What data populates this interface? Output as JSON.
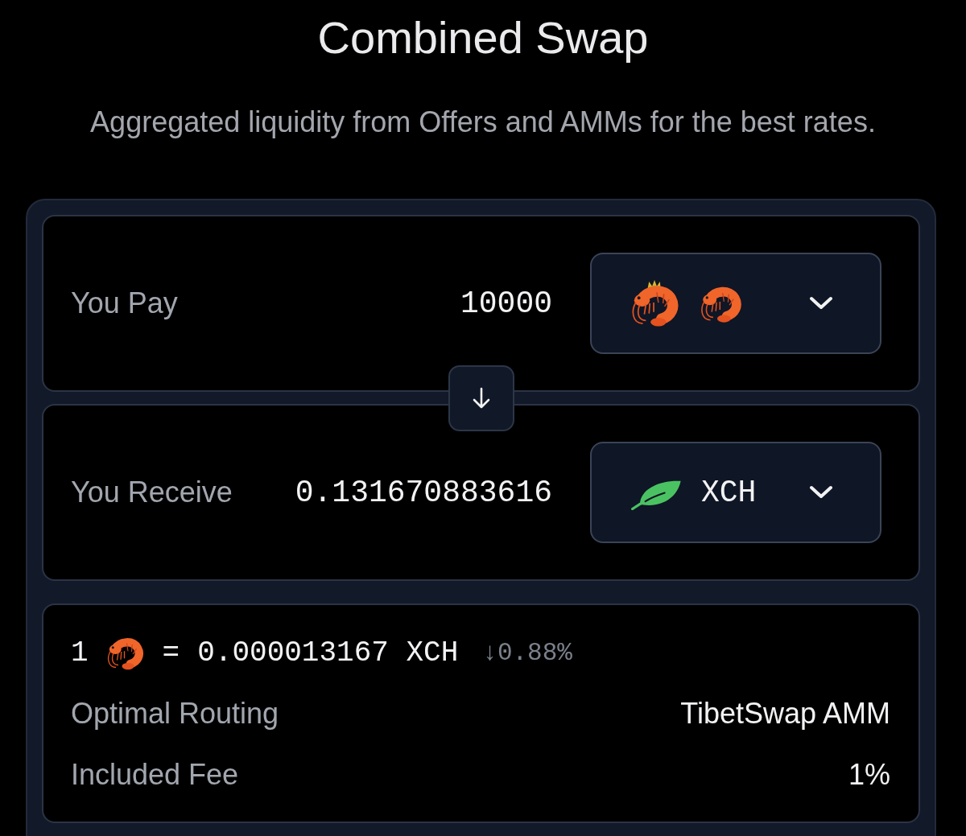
{
  "title": "Combined Swap",
  "subtitle": "Aggregated liquidity from Offers and AMMs for the best rates.",
  "panels": [
    {
      "label": "You Pay",
      "amount": "10000",
      "token": [
        {
          "kind": "crowned-shrimp"
        },
        {
          "kind": "shrimp"
        }
      ]
    },
    {
      "label": "You Receive",
      "amount": "0.131670883616",
      "token": [
        {
          "kind": "leaf"
        },
        {
          "kind": "symbol",
          "text": "XCH"
        }
      ]
    }
  ],
  "rate": [
    {
      "kind": "number",
      "text": "1"
    },
    {
      "kind": "shrimp"
    },
    {
      "kind": "number",
      "text": "="
    },
    {
      "kind": "number",
      "text": "0.000013167 XCH"
    },
    {
      "kind": "change",
      "text": "↓0.88%"
    }
  ],
  "details": [
    {
      "label": "Optimal Routing",
      "value": "TibetSwap AMM"
    },
    {
      "label": "Included Fee",
      "value": "1%"
    }
  ]
}
